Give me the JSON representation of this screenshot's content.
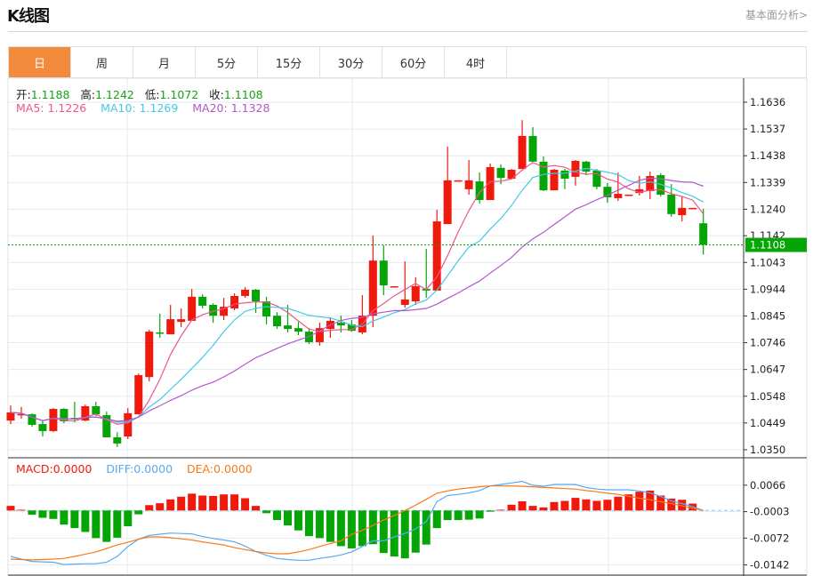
{
  "header": {
    "title": "K线图",
    "link": "基本面分析>"
  },
  "tabs": [
    {
      "label": "日",
      "active": true
    },
    {
      "label": "周"
    },
    {
      "label": "月"
    },
    {
      "label": "5分"
    },
    {
      "label": "15分"
    },
    {
      "label": "30分"
    },
    {
      "label": "60分"
    },
    {
      "label": "4时"
    }
  ],
  "ohlc_legend": {
    "open_label": "开:",
    "open": "1.1188",
    "high_label": "高:",
    "high": "1.1242",
    "low_label": "低:",
    "low": "1.1072",
    "close_label": "收:",
    "close": "1.1108"
  },
  "ma_legend": {
    "ma5_label": "MA5:",
    "ma5": "1.1226",
    "ma10_label": "MA10:",
    "ma10": "1.1269",
    "ma20_label": "MA20:",
    "ma20": "1.1328"
  },
  "macd_legend": {
    "macd_label": "MACD:",
    "macd": "0.0000",
    "diff_label": "DIFF:",
    "diff": "0.0000",
    "dea_label": "DEA:",
    "dea": "0.0000"
  },
  "colors": {
    "up": "#f01a0c",
    "down": "#06a506",
    "ma5": "#f0558c",
    "ma10": "#45c8e3",
    "ma20": "#b358cc",
    "diff": "#5aaaf0",
    "dea": "#f97a1a",
    "accent": "#f28c3c",
    "price_tag": "#06a506"
  },
  "chart_data": [
    {
      "type": "candlestick",
      "yticks": [
        "1.1636",
        "1.1537",
        "1.1438",
        "1.1339",
        "1.1240",
        "1.1142",
        "1.1043",
        "1.0944",
        "1.0845",
        "1.0746",
        "1.0647",
        "1.0548",
        "1.0449",
        "1.0350"
      ],
      "ylim": [
        1.035,
        1.1636
      ],
      "last_price": "1.1108",
      "grid": true,
      "ohlc": [
        [
          1.0458,
          1.0514,
          1.0445,
          1.0488
        ],
        [
          1.0481,
          1.0508,
          1.0465,
          1.0482
        ],
        [
          1.0481,
          1.0485,
          1.0435,
          1.0442
        ],
        [
          1.0445,
          1.0458,
          1.0399,
          1.0419
        ],
        [
          1.0419,
          1.0504,
          1.0415,
          1.0501
        ],
        [
          1.0501,
          1.0504,
          1.0448,
          1.0455
        ],
        [
          1.0468,
          1.0527,
          1.0452,
          1.0462
        ],
        [
          1.0458,
          1.0517,
          1.0455,
          1.0511
        ],
        [
          1.0511,
          1.0527,
          1.0475,
          1.0481
        ],
        [
          1.0478,
          1.0491,
          1.0396,
          1.0396
        ],
        [
          1.0396,
          1.0415,
          1.036,
          1.0373
        ],
        [
          1.0399,
          1.0504,
          1.0389,
          1.0485
        ],
        [
          1.0481,
          1.0632,
          1.0481,
          1.0626
        ],
        [
          1.0619,
          1.0794,
          1.0603,
          1.0787
        ],
        [
          1.0784,
          1.0853,
          1.0764,
          1.0781
        ],
        [
          1.0777,
          1.0886,
          1.0777,
          1.0833
        ],
        [
          1.0823,
          1.0873,
          1.0804,
          1.0833
        ],
        [
          1.0827,
          1.0945,
          1.0827,
          1.0916
        ],
        [
          1.0916,
          1.0925,
          1.0873,
          1.0883
        ],
        [
          1.0886,
          1.0892,
          1.082,
          1.0846
        ],
        [
          1.0846,
          1.0912,
          1.083,
          1.0879
        ],
        [
          1.0873,
          1.0929,
          1.0866,
          1.0919
        ],
        [
          1.0919,
          1.0952,
          1.0912,
          1.0942
        ],
        [
          1.0942,
          1.0945,
          1.0856,
          1.0899
        ],
        [
          1.0899,
          1.0916,
          1.0814,
          1.0843
        ],
        [
          1.0846,
          1.0859,
          1.0797,
          1.0807
        ],
        [
          1.081,
          1.0886,
          1.0784,
          1.0797
        ],
        [
          1.08,
          1.0823,
          1.0774,
          1.0787
        ],
        [
          1.0787,
          1.08,
          1.0741,
          1.0748
        ],
        [
          1.0748,
          1.082,
          1.0735,
          1.08
        ],
        [
          1.0797,
          1.084,
          1.0764,
          1.0827
        ],
        [
          1.082,
          1.0846,
          1.0784,
          1.081
        ],
        [
          1.0814,
          1.083,
          1.0787,
          1.079
        ],
        [
          1.0784,
          1.0922,
          1.0777,
          1.0846
        ],
        [
          1.0846,
          1.1143,
          1.0804,
          1.105
        ],
        [
          1.105,
          1.1106,
          1.0922,
          1.0958
        ],
        [
          1.0955,
          1.0955,
          1.0955,
          1.0955
        ],
        [
          1.0886,
          1.1047,
          1.0876,
          1.0906
        ],
        [
          1.0899,
          1.0988,
          1.0886,
          1.0955
        ],
        [
          1.0945,
          1.1093,
          1.0912,
          1.0939
        ],
        [
          1.0939,
          1.1238,
          1.0939,
          1.1195
        ],
        [
          1.1185,
          1.1472,
          1.1185,
          1.1347
        ],
        [
          1.1347,
          1.1347,
          1.1347,
          1.1347
        ],
        [
          1.1314,
          1.1422,
          1.1294,
          1.1347
        ],
        [
          1.1343,
          1.1376,
          1.1261,
          1.1274
        ],
        [
          1.1274,
          1.1409,
          1.1274,
          1.1396
        ],
        [
          1.1393,
          1.1406,
          1.1333,
          1.1356
        ],
        [
          1.1353,
          1.1389,
          1.1353,
          1.1386
        ],
        [
          1.1389,
          1.157,
          1.1389,
          1.1511
        ],
        [
          1.1511,
          1.1544,
          1.1416,
          1.1416
        ],
        [
          1.1416,
          1.1435,
          1.1307,
          1.131
        ],
        [
          1.131,
          1.1389,
          1.131,
          1.1386
        ],
        [
          1.1383,
          1.1389,
          1.1314,
          1.1353
        ],
        [
          1.136,
          1.1422,
          1.1327,
          1.1419
        ],
        [
          1.1416,
          1.1419,
          1.1366,
          1.1379
        ],
        [
          1.1383,
          1.1389,
          1.1314,
          1.1323
        ],
        [
          1.1323,
          1.1337,
          1.1264,
          1.1284
        ],
        [
          1.1281,
          1.1376,
          1.1271,
          1.1297
        ],
        [
          1.1294,
          1.1294,
          1.1294,
          1.1294
        ],
        [
          1.13,
          1.1363,
          1.1291,
          1.1314
        ],
        [
          1.1307,
          1.1379,
          1.1277,
          1.1363
        ],
        [
          1.1366,
          1.1373,
          1.1287,
          1.1294
        ],
        [
          1.1294,
          1.1333,
          1.1212,
          1.1222
        ],
        [
          1.1218,
          1.1287,
          1.1195,
          1.1245
        ],
        [
          1.1245,
          1.1245,
          1.1245,
          1.1245
        ],
        [
          1.1188,
          1.1242,
          1.1072,
          1.1108
        ]
      ],
      "moving_averages": [
        "MA5",
        "MA10",
        "MA20"
      ]
    },
    {
      "type": "bar+line",
      "yticks": [
        "0.0066",
        "-0.0003",
        "-0.0072",
        "-0.0142"
      ],
      "ylim": [
        -0.016,
        0.012
      ],
      "macd": [
        0.0012,
        0.0002,
        -0.0011,
        -0.0019,
        -0.0022,
        -0.0037,
        -0.0046,
        -0.0056,
        -0.0072,
        -0.0082,
        -0.0071,
        -0.0041,
        -0.001,
        0.0014,
        0.0019,
        0.0029,
        0.0036,
        0.0044,
        0.0039,
        0.0038,
        0.0042,
        0.0042,
        0.0032,
        0.0012,
        -0.0007,
        -0.0025,
        -0.0039,
        -0.0052,
        -0.0067,
        -0.0072,
        -0.0082,
        -0.0093,
        -0.0099,
        -0.0093,
        -0.0088,
        -0.0111,
        -0.012,
        -0.0125,
        -0.011,
        -0.0089,
        -0.0046,
        -0.0025,
        -0.0025,
        -0.0024,
        -0.0021,
        -0.0003,
        0.0002,
        0.0015,
        0.0024,
        0.0012,
        0.0008,
        0.0022,
        0.0025,
        0.0033,
        0.0029,
        0.0025,
        0.0028,
        0.0036,
        0.0042,
        0.0049,
        0.0052,
        0.0039,
        0.0031,
        0.0028,
        0.0018,
        0.0
      ],
      "diff": [
        -0.012,
        -0.0127,
        -0.0133,
        -0.0134,
        -0.0135,
        -0.0141,
        -0.014,
        -0.0139,
        -0.0139,
        -0.0135,
        -0.012,
        -0.0094,
        -0.0075,
        -0.0065,
        -0.0062,
        -0.0059,
        -0.006,
        -0.0061,
        -0.0068,
        -0.0073,
        -0.0077,
        -0.0082,
        -0.0093,
        -0.0107,
        -0.0117,
        -0.0125,
        -0.0128,
        -0.013,
        -0.013,
        -0.0125,
        -0.0121,
        -0.0116,
        -0.0108,
        -0.0094,
        -0.0079,
        -0.0079,
        -0.0069,
        -0.006,
        -0.0048,
        -0.0029,
        0.0023,
        0.0039,
        0.0042,
        0.0046,
        0.0052,
        0.0064,
        0.0068,
        0.0072,
        0.0076,
        0.0066,
        0.0063,
        0.0068,
        0.0068,
        0.0068,
        0.006,
        0.0056,
        0.0054,
        0.0054,
        0.0054,
        0.0051,
        0.0046,
        0.0037,
        0.0025,
        0.0018,
        0.001,
        0.0
      ],
      "dea": [
        -0.0127,
        -0.0128,
        -0.0129,
        -0.0128,
        -0.0127,
        -0.0125,
        -0.012,
        -0.0114,
        -0.0108,
        -0.0099,
        -0.009,
        -0.0083,
        -0.0075,
        -0.0069,
        -0.0069,
        -0.0071,
        -0.0074,
        -0.0077,
        -0.0082,
        -0.0086,
        -0.009,
        -0.0097,
        -0.0102,
        -0.0107,
        -0.0111,
        -0.0113,
        -0.0113,
        -0.0108,
        -0.0102,
        -0.0094,
        -0.0086,
        -0.0079,
        -0.0062,
        -0.0052,
        -0.0039,
        -0.0025,
        -0.0013,
        0.0,
        0.0014,
        0.0029,
        0.0045,
        0.0051,
        0.0056,
        0.0059,
        0.0062,
        0.0064,
        0.0064,
        0.0064,
        0.0063,
        0.0062,
        0.006,
        0.0059,
        0.0057,
        0.0056,
        0.0052,
        0.0049,
        0.0045,
        0.0042,
        0.0037,
        0.0032,
        0.0028,
        0.0023,
        0.0018,
        0.0012,
        0.0006,
        0.0
      ]
    }
  ]
}
